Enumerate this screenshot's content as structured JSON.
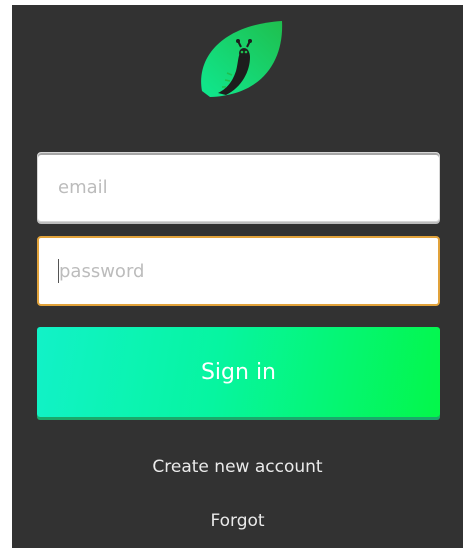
{
  "app": {
    "logo_icon": "leaf-caterpillar-icon",
    "accent_color": "#00f07a"
  },
  "form": {
    "email": {
      "value": "",
      "placeholder": "email"
    },
    "password": {
      "value": "",
      "placeholder": "password",
      "focused": true
    },
    "signin_label": "Sign in"
  },
  "links": {
    "create_account": "Create new account",
    "forgot": "Forgot"
  }
}
